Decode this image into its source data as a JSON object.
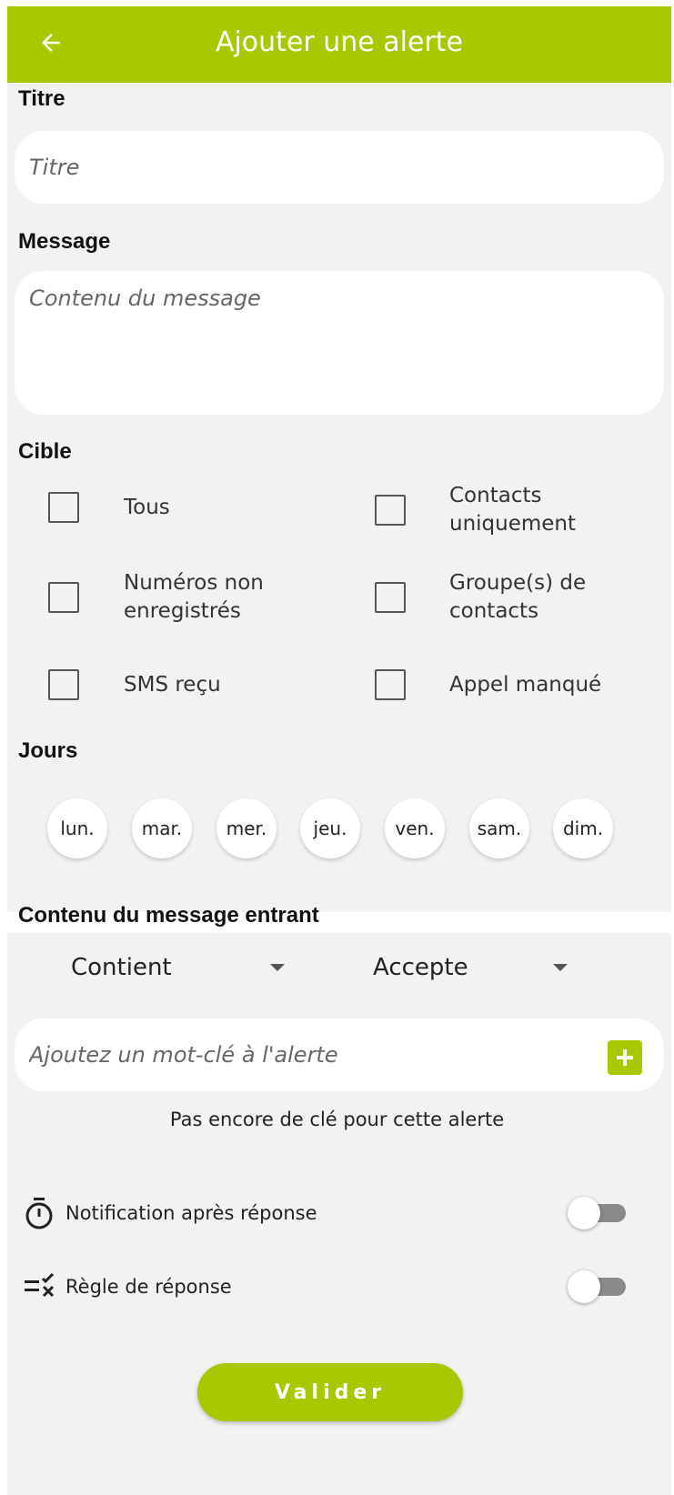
{
  "header": {
    "title": "Ajouter une alerte",
    "back_icon": "arrow-left-icon"
  },
  "titre": {
    "label": "Titre",
    "value": "",
    "placeholder": "Titre"
  },
  "message": {
    "label": "Message",
    "value": "",
    "placeholder": "Contenu du message"
  },
  "cible": {
    "label": "Cible",
    "options": [
      {
        "label": "Tous",
        "checked": false
      },
      {
        "label": "Contacts uniquement",
        "checked": false
      },
      {
        "label": "Numéros non enregistrés",
        "checked": false
      },
      {
        "label": "Groupe(s) de contacts",
        "checked": false
      },
      {
        "label": "SMS reçu",
        "checked": false
      },
      {
        "label": "Appel manqué",
        "checked": false
      }
    ]
  },
  "jours": {
    "label": "Jours",
    "days": [
      "lun.",
      "mar.",
      "mer.",
      "jeu.",
      "ven.",
      "sam.",
      "dim."
    ]
  },
  "incoming": {
    "label": "Contenu du message entrant",
    "condition": "Contient",
    "action": "Accepte",
    "keyword_placeholder": "Ajoutez un mot-clé à l'alerte",
    "keyword_value": "",
    "empty_text": "Pas encore de clé pour cette alerte"
  },
  "toggles": [
    {
      "label": "Notification après réponse",
      "icon": "timer-icon",
      "on": false
    },
    {
      "label": "Règle de réponse",
      "icon": "rule-icon",
      "on": false
    }
  ],
  "submit": {
    "label": "Valider"
  },
  "colors": {
    "accent": "#a8c800",
    "background": "#f2f2f2",
    "field": "#ffffff"
  }
}
